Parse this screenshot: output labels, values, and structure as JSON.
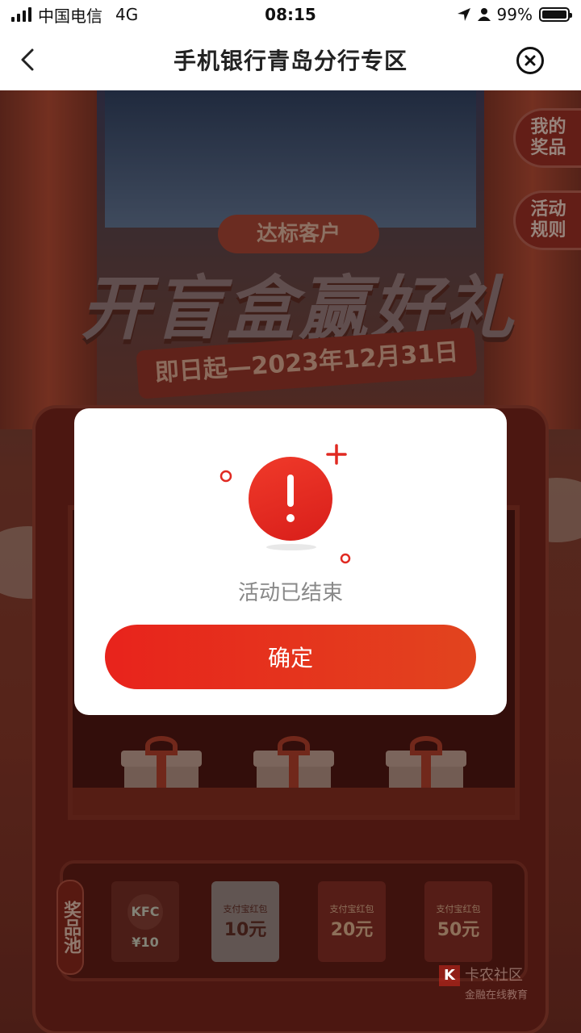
{
  "status_bar": {
    "carrier": "中国电信",
    "network": "4G",
    "time": "08:15",
    "battery_percent": "99%",
    "battery_level": 0.99
  },
  "nav": {
    "title": "手机银行青岛分行专区"
  },
  "banner": {
    "tag": "达标客户",
    "title": "开盲盒赢好礼",
    "date_ribbon": "即日起—2023年12月31日"
  },
  "side_tabs": {
    "my_prizes": "我的奖品",
    "rules": "活动规则"
  },
  "prize_pool": {
    "label": "奖品池",
    "cards": [
      {
        "brand": "KFC",
        "value": "¥10"
      },
      {
        "title": "支付宝红包",
        "value": "10元"
      },
      {
        "title": "支付宝红包",
        "value": "20元"
      },
      {
        "title": "支付宝红包",
        "value": "50元"
      }
    ]
  },
  "watermark": {
    "k": "K",
    "name": "卡农社区",
    "sub": "金融在线教育"
  },
  "dialog": {
    "message": "活动已结束",
    "confirm_label": "确定"
  },
  "colors": {
    "accent_red": "#e8231c",
    "alert_red": "#e02a22"
  }
}
